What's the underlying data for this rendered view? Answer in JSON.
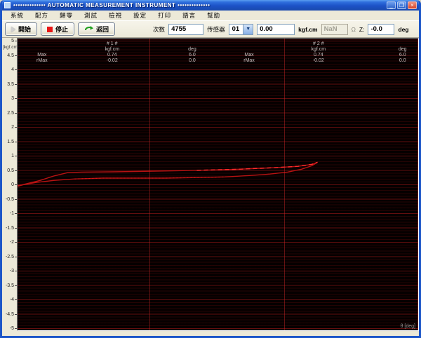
{
  "window": {
    "title": "••••••••••••••  AUTOMATIC MEASUREMENT INSTRUMENT  ••••••••••••••",
    "controls": {
      "minimize": "_",
      "maximize": "❐",
      "close": "×"
    }
  },
  "menu": {
    "items": [
      "系統",
      "配方",
      "歸零",
      "測試",
      "檢視",
      "設定",
      "打印",
      "語言",
      "幫助"
    ]
  },
  "toolbar": {
    "start": "開始",
    "stop": "停止",
    "back": "返回",
    "count_label": "次数",
    "count_value": "4755",
    "sensor_label": "传感器",
    "sensor_value": "01",
    "torque_value": "0.00",
    "torque_unit": "kgf.cm",
    "resistance_value": "NaN",
    "resistance_unit": "Ω",
    "z_label": "Z:",
    "z_value": "-0.0",
    "z_unit": "deg"
  },
  "chart_data": {
    "type": "line",
    "title": "",
    "xlabel": "θ [deg]",
    "ylabel": "[kgf.cm]",
    "xlim": [
      0,
      8
    ],
    "ylim": [
      -5,
      5
    ],
    "ytick_step": 0.5,
    "ytick_labels": [
      "5",
      "4.5",
      "4",
      "3.5",
      "3",
      "2.5",
      "2",
      "1.5",
      "1",
      "0.5",
      "0",
      "-0.5",
      "-1",
      "-1.5",
      "-2",
      "-2.5",
      "-3",
      "-3.5",
      "-4",
      "-4.5",
      "-5"
    ],
    "grid": {
      "minor_step": 0.1,
      "major_step": 0.5,
      "vertical_fracs": [
        0.329,
        0.665,
        0.998
      ]
    },
    "series": [
      {
        "name": "torque-angle-hysteresis-loop",
        "color": "#b81212",
        "width": 1.4,
        "dash": "",
        "points": [
          [
            0.0,
            -0.05
          ],
          [
            0.17,
            0.02
          ],
          [
            0.45,
            0.14
          ],
          [
            0.72,
            0.29
          ],
          [
            1.0,
            0.41
          ],
          [
            1.28,
            0.43
          ],
          [
            1.91,
            0.44
          ],
          [
            2.75,
            0.46
          ],
          [
            3.58,
            0.49
          ],
          [
            4.42,
            0.53
          ],
          [
            5.11,
            0.58
          ],
          [
            5.6,
            0.63
          ],
          [
            5.88,
            0.7
          ],
          [
            5.99,
            0.77
          ],
          [
            5.88,
            0.65
          ],
          [
            5.67,
            0.53
          ],
          [
            5.39,
            0.43
          ],
          [
            5.04,
            0.36
          ],
          [
            4.63,
            0.31
          ],
          [
            4.14,
            0.26
          ],
          [
            3.58,
            0.24
          ],
          [
            2.95,
            0.22
          ],
          [
            2.33,
            0.22
          ],
          [
            1.7,
            0.22
          ],
          [
            1.14,
            0.19
          ],
          [
            0.72,
            0.14
          ],
          [
            0.38,
            0.07
          ],
          [
            0.14,
            0.0
          ],
          [
            0.01,
            -0.06
          ]
        ]
      },
      {
        "name": "upper-branch-highlight",
        "color": "#ff2d2d",
        "width": 1.4,
        "dash": "6 4",
        "points": [
          [
            3.58,
            0.49
          ],
          [
            4.42,
            0.53
          ],
          [
            5.11,
            0.58
          ],
          [
            5.6,
            0.63
          ],
          [
            5.88,
            0.7
          ],
          [
            5.99,
            0.77
          ]
        ]
      },
      {
        "name": "lower-branch-highlight",
        "color": "#e01818",
        "width": 1,
        "dash": "2 3",
        "points": [
          [
            1.14,
            0.19
          ],
          [
            1.7,
            0.22
          ],
          [
            2.33,
            0.22
          ],
          [
            2.95,
            0.22
          ],
          [
            3.58,
            0.24
          ],
          [
            4.14,
            0.26
          ]
        ]
      }
    ],
    "stats": {
      "channels": [
        {
          "title": "# 1 #",
          "units": [
            "kgf.cm",
            "deg"
          ],
          "rows": [
            [
              "Max",
              "0.74",
              "6.0"
            ],
            [
              "rMax",
              "-0.02",
              "0.0"
            ]
          ],
          "x_fracs": {
            "label": 0.061,
            "col1": 0.236,
            "col2": 0.436
          }
        },
        {
          "title": "# 2 #",
          "units": [
            "kgf.cm",
            "deg"
          ],
          "rows": [
            [
              "Max",
              "0.74",
              "6.0"
            ],
            [
              "rMax",
              "-0.02",
              "0.0"
            ]
          ],
          "x_fracs": {
            "label": 0.578,
            "col1": 0.751,
            "col2": 0.961
          }
        }
      ]
    }
  }
}
